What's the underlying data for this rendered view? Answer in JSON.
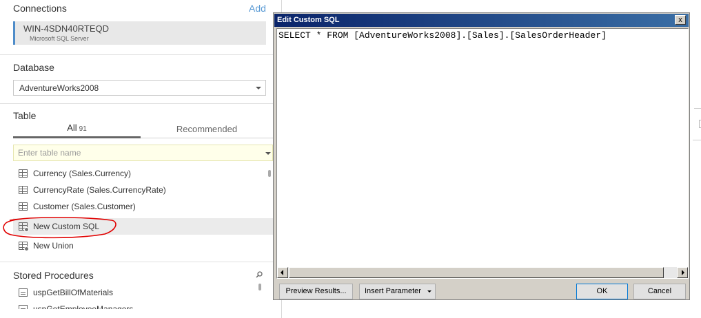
{
  "connections": {
    "title": "Connections",
    "add_label": "Add",
    "connection": {
      "name": "WIN-4SDN40RTEQD",
      "type": "Microsoft SQL Server"
    }
  },
  "database": {
    "title": "Database",
    "selected": "AdventureWorks2008"
  },
  "table": {
    "title": "Table",
    "tabs": [
      {
        "label": "All",
        "count": "91"
      },
      {
        "label": "Recommended"
      }
    ],
    "search_placeholder": "Enter table name",
    "items": [
      {
        "label": "Currency (Sales.Currency)",
        "icon": "table-icon"
      },
      {
        "label": "CurrencyRate (Sales.CurrencyRate)",
        "icon": "table-icon"
      },
      {
        "label": "Customer (Sales.Customer)",
        "icon": "table-icon"
      },
      {
        "label": "New Custom SQL",
        "icon": "custom-sql-icon"
      },
      {
        "label": "New Union",
        "icon": "union-icon"
      }
    ]
  },
  "stored_procedures": {
    "title": "Stored Procedures",
    "items": [
      {
        "label": "uspGetBillOfMaterials"
      },
      {
        "label": "uspGetEmployeeManagers"
      }
    ]
  },
  "dialog": {
    "title": "Edit Custom SQL",
    "close_label": "x",
    "sql": "SELECT * FROM [AdventureWorks2008].[Sales].[SalesOrderHeader]",
    "buttons": {
      "preview": "Preview Results...",
      "insert": "Insert Parameter",
      "ok": "OK",
      "cancel": "Cancel"
    }
  },
  "colors": {
    "accent": "#4e8cc9",
    "link": "#5b9bd5",
    "annotation": "#e00000"
  }
}
